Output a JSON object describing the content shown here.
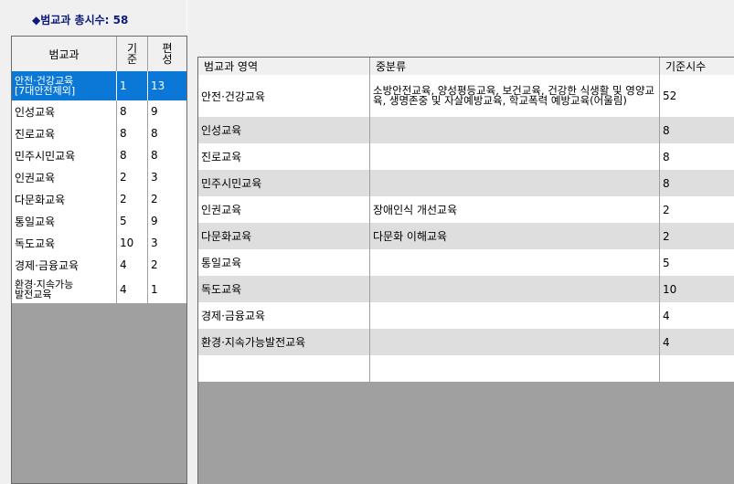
{
  "summary": {
    "total_label": "◆범교과 총시수: 58"
  },
  "left_table": {
    "headers": {
      "subject": "범교과",
      "standard": "기준",
      "organized": "편성"
    },
    "rows": [
      {
        "subject": "안전·건강교육 [7대안전제외]",
        "subject_line1": "안전·건강교육",
        "subject_line2": "[7대안전제외]",
        "standard": "1",
        "organized": "13",
        "selected": true
      },
      {
        "subject": "인성교육",
        "standard": "8",
        "organized": "9"
      },
      {
        "subject": "진로교육",
        "standard": "8",
        "organized": "8"
      },
      {
        "subject": "민주시민교육",
        "standard": "8",
        "organized": "8"
      },
      {
        "subject": "인권교육",
        "standard": "2",
        "organized": "3"
      },
      {
        "subject": "다문화교육",
        "standard": "2",
        "organized": "2"
      },
      {
        "subject": "통일교육",
        "standard": "5",
        "organized": "9"
      },
      {
        "subject": "독도교육",
        "standard": "10",
        "organized": "3"
      },
      {
        "subject": "경제·금융교육",
        "standard": "4",
        "organized": "2"
      },
      {
        "subject": "환경·지속가능 발전교육",
        "subject_line1": "환경·지속가능",
        "subject_line2": "발전교육",
        "standard": "4",
        "organized": "1"
      }
    ]
  },
  "right_table": {
    "headers": {
      "area": "범교과 영역",
      "subcategory": "중분류",
      "hours": "기준시수"
    },
    "rows": [
      {
        "area": "안전·건강교육",
        "subcategory": "소방안전교육, 양성평등교육, 보건교육, 건강한 식생활 및 영양교육, 생명존중 및 자살예방교육, 학교폭력 예방교육(어울림)",
        "hours": "52"
      },
      {
        "area": "인성교육",
        "subcategory": "",
        "hours": "8"
      },
      {
        "area": "진로교육",
        "subcategory": "",
        "hours": "8"
      },
      {
        "area": "민주시민교육",
        "subcategory": "",
        "hours": "8"
      },
      {
        "area": "인권교육",
        "subcategory": "장애인식 개선교육",
        "hours": "2"
      },
      {
        "area": "다문화교육",
        "subcategory": "다문화 이해교육",
        "hours": "2"
      },
      {
        "area": "통일교육",
        "subcategory": "",
        "hours": "5"
      },
      {
        "area": "독도교육",
        "subcategory": "",
        "hours": "10"
      },
      {
        "area": "경제·금융교육",
        "subcategory": "",
        "hours": "4"
      },
      {
        "area": "환경·지속가능발전교육",
        "subcategory": "",
        "hours": "4"
      },
      {
        "area": "",
        "subcategory": "",
        "hours": ""
      }
    ]
  }
}
